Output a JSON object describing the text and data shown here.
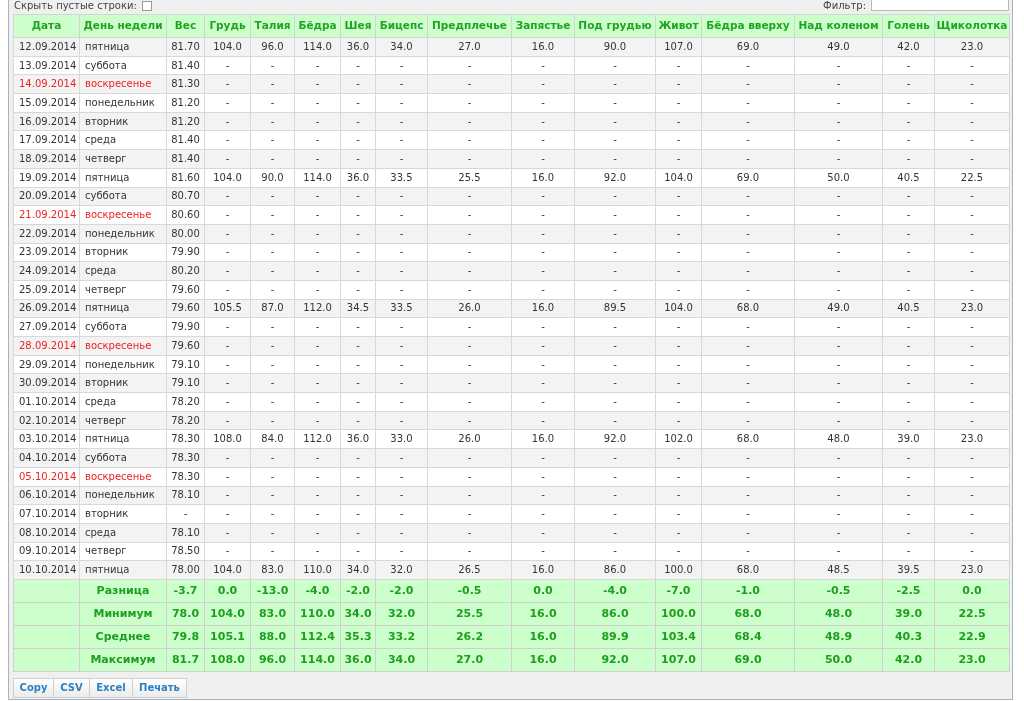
{
  "toolbar": {
    "hide_empty_label": "Скрыть пустые строки:",
    "hide_empty_checked": false,
    "filter_label": "Фильтр:"
  },
  "table": {
    "columns": [
      "Дата",
      "День недели",
      "Вес",
      "Грудь",
      "Талия",
      "Бёдра",
      "Шея",
      "Бицепс",
      "Предплечье",
      "Запястье",
      "Под грудью",
      "Живот",
      "Бёдра вверху",
      "Над коленом",
      "Голень",
      "Щиколотка"
    ],
    "rows": [
      {
        "weekend": false,
        "cells": [
          "12.09.2014",
          "пятница",
          "81.70",
          "104.0",
          "96.0",
          "114.0",
          "36.0",
          "34.0",
          "27.0",
          "16.0",
          "90.0",
          "107.0",
          "69.0",
          "49.0",
          "42.0",
          "23.0"
        ]
      },
      {
        "weekend": false,
        "cells": [
          "13.09.2014",
          "суббота",
          "81.40",
          "-",
          "-",
          "-",
          "-",
          "-",
          "-",
          "-",
          "-",
          "-",
          "-",
          "-",
          "-",
          "-"
        ]
      },
      {
        "weekend": true,
        "cells": [
          "14.09.2014",
          "воскресенье",
          "81.30",
          "-",
          "-",
          "-",
          "-",
          "-",
          "-",
          "-",
          "-",
          "-",
          "-",
          "-",
          "-",
          "-"
        ]
      },
      {
        "weekend": false,
        "cells": [
          "15.09.2014",
          "понедельник",
          "81.20",
          "-",
          "-",
          "-",
          "-",
          "-",
          "-",
          "-",
          "-",
          "-",
          "-",
          "-",
          "-",
          "-"
        ]
      },
      {
        "weekend": false,
        "cells": [
          "16.09.2014",
          "вторник",
          "81.20",
          "-",
          "-",
          "-",
          "-",
          "-",
          "-",
          "-",
          "-",
          "-",
          "-",
          "-",
          "-",
          "-"
        ]
      },
      {
        "weekend": false,
        "cells": [
          "17.09.2014",
          "среда",
          "81.40",
          "-",
          "-",
          "-",
          "-",
          "-",
          "-",
          "-",
          "-",
          "-",
          "-",
          "-",
          "-",
          "-"
        ]
      },
      {
        "weekend": false,
        "cells": [
          "18.09.2014",
          "четверг",
          "81.40",
          "-",
          "-",
          "-",
          "-",
          "-",
          "-",
          "-",
          "-",
          "-",
          "-",
          "-",
          "-",
          "-"
        ]
      },
      {
        "weekend": false,
        "cells": [
          "19.09.2014",
          "пятница",
          "81.60",
          "104.0",
          "90.0",
          "114.0",
          "36.0",
          "33.5",
          "25.5",
          "16.0",
          "92.0",
          "104.0",
          "69.0",
          "50.0",
          "40.5",
          "22.5"
        ]
      },
      {
        "weekend": false,
        "cells": [
          "20.09.2014",
          "суббота",
          "80.70",
          "-",
          "-",
          "-",
          "-",
          "-",
          "-",
          "-",
          "-",
          "-",
          "-",
          "-",
          "-",
          "-"
        ]
      },
      {
        "weekend": true,
        "cells": [
          "21.09.2014",
          "воскресенье",
          "80.60",
          "-",
          "-",
          "-",
          "-",
          "-",
          "-",
          "-",
          "-",
          "-",
          "-",
          "-",
          "-",
          "-"
        ]
      },
      {
        "weekend": false,
        "cells": [
          "22.09.2014",
          "понедельник",
          "80.00",
          "-",
          "-",
          "-",
          "-",
          "-",
          "-",
          "-",
          "-",
          "-",
          "-",
          "-",
          "-",
          "-"
        ]
      },
      {
        "weekend": false,
        "cells": [
          "23.09.2014",
          "вторник",
          "79.90",
          "-",
          "-",
          "-",
          "-",
          "-",
          "-",
          "-",
          "-",
          "-",
          "-",
          "-",
          "-",
          "-"
        ]
      },
      {
        "weekend": false,
        "cells": [
          "24.09.2014",
          "среда",
          "80.20",
          "-",
          "-",
          "-",
          "-",
          "-",
          "-",
          "-",
          "-",
          "-",
          "-",
          "-",
          "-",
          "-"
        ]
      },
      {
        "weekend": false,
        "cells": [
          "25.09.2014",
          "четверг",
          "79.60",
          "-",
          "-",
          "-",
          "-",
          "-",
          "-",
          "-",
          "-",
          "-",
          "-",
          "-",
          "-",
          "-"
        ]
      },
      {
        "weekend": false,
        "cells": [
          "26.09.2014",
          "пятница",
          "79.60",
          "105.5",
          "87.0",
          "112.0",
          "34.5",
          "33.5",
          "26.0",
          "16.0",
          "89.5",
          "104.0",
          "68.0",
          "49.0",
          "40.5",
          "23.0"
        ]
      },
      {
        "weekend": false,
        "cells": [
          "27.09.2014",
          "суббота",
          "79.90",
          "-",
          "-",
          "-",
          "-",
          "-",
          "-",
          "-",
          "-",
          "-",
          "-",
          "-",
          "-",
          "-"
        ]
      },
      {
        "weekend": true,
        "cells": [
          "28.09.2014",
          "воскресенье",
          "79.60",
          "-",
          "-",
          "-",
          "-",
          "-",
          "-",
          "-",
          "-",
          "-",
          "-",
          "-",
          "-",
          "-"
        ]
      },
      {
        "weekend": false,
        "cells": [
          "29.09.2014",
          "понедельник",
          "79.10",
          "-",
          "-",
          "-",
          "-",
          "-",
          "-",
          "-",
          "-",
          "-",
          "-",
          "-",
          "-",
          "-"
        ]
      },
      {
        "weekend": false,
        "cells": [
          "30.09.2014",
          "вторник",
          "79.10",
          "-",
          "-",
          "-",
          "-",
          "-",
          "-",
          "-",
          "-",
          "-",
          "-",
          "-",
          "-",
          "-"
        ]
      },
      {
        "weekend": false,
        "cells": [
          "01.10.2014",
          "среда",
          "78.20",
          "-",
          "-",
          "-",
          "-",
          "-",
          "-",
          "-",
          "-",
          "-",
          "-",
          "-",
          "-",
          "-"
        ]
      },
      {
        "weekend": false,
        "cells": [
          "02.10.2014",
          "четверг",
          "78.20",
          "-",
          "-",
          "-",
          "-",
          "-",
          "-",
          "-",
          "-",
          "-",
          "-",
          "-",
          "-",
          "-"
        ]
      },
      {
        "weekend": false,
        "cells": [
          "03.10.2014",
          "пятница",
          "78.30",
          "108.0",
          "84.0",
          "112.0",
          "36.0",
          "33.0",
          "26.0",
          "16.0",
          "92.0",
          "102.0",
          "68.0",
          "48.0",
          "39.0",
          "23.0"
        ]
      },
      {
        "weekend": false,
        "cells": [
          "04.10.2014",
          "суббота",
          "78.30",
          "-",
          "-",
          "-",
          "-",
          "-",
          "-",
          "-",
          "-",
          "-",
          "-",
          "-",
          "-",
          "-"
        ]
      },
      {
        "weekend": true,
        "cells": [
          "05.10.2014",
          "воскресенье",
          "78.30",
          "-",
          "-",
          "-",
          "-",
          "-",
          "-",
          "-",
          "-",
          "-",
          "-",
          "-",
          "-",
          "-"
        ]
      },
      {
        "weekend": false,
        "cells": [
          "06.10.2014",
          "понедельник",
          "78.10",
          "-",
          "-",
          "-",
          "-",
          "-",
          "-",
          "-",
          "-",
          "-",
          "-",
          "-",
          "-",
          "-"
        ]
      },
      {
        "weekend": false,
        "cells": [
          "07.10.2014",
          "вторник",
          "-",
          "-",
          "-",
          "-",
          "-",
          "-",
          "-",
          "-",
          "-",
          "-",
          "-",
          "-",
          "-",
          "-"
        ]
      },
      {
        "weekend": false,
        "cells": [
          "08.10.2014",
          "среда",
          "78.10",
          "-",
          "-",
          "-",
          "-",
          "-",
          "-",
          "-",
          "-",
          "-",
          "-",
          "-",
          "-",
          "-"
        ]
      },
      {
        "weekend": false,
        "cells": [
          "09.10.2014",
          "четверг",
          "78.50",
          "-",
          "-",
          "-",
          "-",
          "-",
          "-",
          "-",
          "-",
          "-",
          "-",
          "-",
          "-",
          "-"
        ]
      },
      {
        "weekend": false,
        "cells": [
          "10.10.2014",
          "пятница",
          "78.00",
          "104.0",
          "83.0",
          "110.0",
          "34.0",
          "32.0",
          "26.5",
          "16.0",
          "86.0",
          "100.0",
          "68.0",
          "48.5",
          "39.5",
          "23.0"
        ]
      }
    ],
    "summary_rows": [
      {
        "label": "Разница",
        "values": [
          "-3.7",
          "0.0",
          "-13.0",
          "-4.0",
          "-2.0",
          "-2.0",
          "-0.5",
          "0.0",
          "-4.0",
          "-7.0",
          "-1.0",
          "-0.5",
          "-2.5",
          "0.0"
        ]
      },
      {
        "label": "Минимум",
        "values": [
          "78.0",
          "104.0",
          "83.0",
          "110.0",
          "34.0",
          "32.0",
          "25.5",
          "16.0",
          "86.0",
          "100.0",
          "68.0",
          "48.0",
          "39.0",
          "22.5"
        ]
      },
      {
        "label": "Среднее",
        "values": [
          "79.8",
          "105.1",
          "88.0",
          "112.4",
          "35.3",
          "33.2",
          "26.2",
          "16.0",
          "89.9",
          "103.4",
          "68.4",
          "48.9",
          "40.3",
          "22.9"
        ]
      },
      {
        "label": "Максимум",
        "values": [
          "81.7",
          "108.0",
          "96.0",
          "114.0",
          "36.0",
          "34.0",
          "27.0",
          "16.0",
          "92.0",
          "107.0",
          "69.0",
          "50.0",
          "42.0",
          "23.0"
        ]
      }
    ]
  },
  "buttons": [
    "Copy",
    "CSV",
    "Excel",
    "Печать"
  ]
}
